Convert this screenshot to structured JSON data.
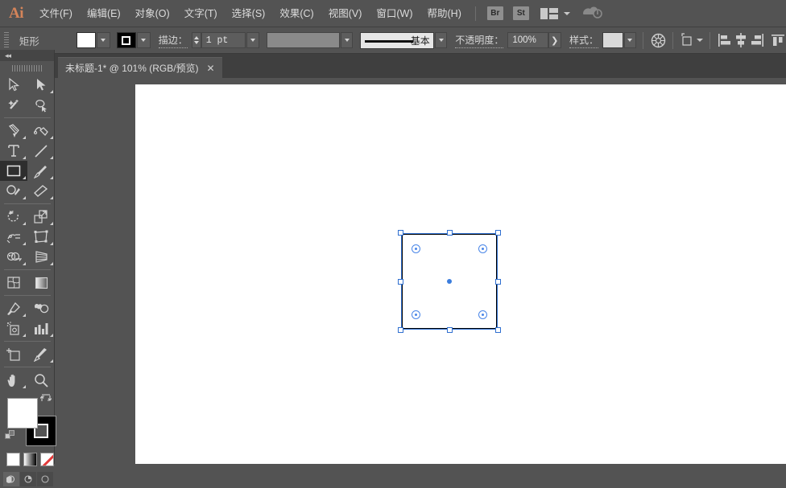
{
  "app": {
    "name": "Ai",
    "logo_color": "#d4845a"
  },
  "menubar": {
    "items": [
      {
        "label": "文件(F)",
        "name": "menu-file"
      },
      {
        "label": "编辑(E)",
        "name": "menu-edit"
      },
      {
        "label": "对象(O)",
        "name": "menu-object"
      },
      {
        "label": "文字(T)",
        "name": "menu-type"
      },
      {
        "label": "选择(S)",
        "name": "menu-select"
      },
      {
        "label": "效果(C)",
        "name": "menu-effect"
      },
      {
        "label": "视图(V)",
        "name": "menu-view"
      },
      {
        "label": "窗口(W)",
        "name": "menu-window"
      },
      {
        "label": "帮助(H)",
        "name": "menu-help"
      }
    ],
    "bridge_button": "Br",
    "stock_button": "St",
    "workspace_icon": "workspace-switcher-icon",
    "cc_icon": "creative-cloud-icon"
  },
  "controlbar": {
    "object_label": "矩形",
    "fill_color": "#ffffff",
    "stroke_color": "#000000",
    "stroke_label": "描边：",
    "stroke_weight": "1 pt",
    "profile_label": "",
    "brush_label": "基本",
    "opacity_label": "不透明度：",
    "opacity_value": "100%",
    "style_label": "样式：",
    "recolor_icon": "recolor-artwork-icon",
    "transform_icon": "transform-icon",
    "align_icons": [
      {
        "name": "align-left-icon"
      },
      {
        "name": "align-center-horizontal-icon"
      },
      {
        "name": "align-right-icon"
      },
      {
        "name": "align-top-icon"
      }
    ]
  },
  "tabbar": {
    "document_title": "未标题-1* @ 101% (RGB/预览)",
    "close_label": "✕"
  },
  "toolpanel": {
    "collapse_label": "◂◂",
    "tools": [
      {
        "name": "selection-tool",
        "row": 0,
        "col": 0,
        "selected": false
      },
      {
        "name": "direct-selection-tool",
        "row": 0,
        "col": 1,
        "selected": false
      },
      {
        "name": "magic-wand-tool",
        "row": 1,
        "col": 0,
        "selected": false
      },
      {
        "name": "lasso-tool",
        "row": 1,
        "col": 1,
        "selected": false
      },
      {
        "name": "pen-tool",
        "row": 2,
        "col": 0,
        "selected": false
      },
      {
        "name": "curvature-tool",
        "row": 2,
        "col": 1,
        "selected": false
      },
      {
        "name": "type-tool",
        "row": 3,
        "col": 0,
        "selected": false
      },
      {
        "name": "line-segment-tool",
        "row": 3,
        "col": 1,
        "selected": false
      },
      {
        "name": "rectangle-tool",
        "row": 4,
        "col": 0,
        "selected": true
      },
      {
        "name": "paintbrush-tool",
        "row": 4,
        "col": 1,
        "selected": false
      },
      {
        "name": "shaper-tool",
        "row": 5,
        "col": 0,
        "selected": false
      },
      {
        "name": "eraser-tool",
        "row": 5,
        "col": 1,
        "selected": false
      },
      {
        "name": "rotate-tool",
        "row": 6,
        "col": 0,
        "selected": false
      },
      {
        "name": "scale-tool",
        "row": 6,
        "col": 1,
        "selected": false
      },
      {
        "name": "width-tool",
        "row": 7,
        "col": 0,
        "selected": false
      },
      {
        "name": "free-transform-tool",
        "row": 7,
        "col": 1,
        "selected": false
      },
      {
        "name": "shape-builder-tool",
        "row": 8,
        "col": 0,
        "selected": false
      },
      {
        "name": "perspective-grid-tool",
        "row": 8,
        "col": 1,
        "selected": false
      },
      {
        "name": "mesh-tool",
        "row": 9,
        "col": 0,
        "selected": false
      },
      {
        "name": "gradient-tool",
        "row": 9,
        "col": 1,
        "selected": false
      },
      {
        "name": "eyedropper-tool",
        "row": 10,
        "col": 0,
        "selected": false
      },
      {
        "name": "blend-tool",
        "row": 10,
        "col": 1,
        "selected": false
      },
      {
        "name": "symbol-sprayer-tool",
        "row": 11,
        "col": 0,
        "selected": false
      },
      {
        "name": "column-graph-tool",
        "row": 11,
        "col": 1,
        "selected": false
      },
      {
        "name": "artboard-tool",
        "row": 12,
        "col": 0,
        "selected": false
      },
      {
        "name": "slice-tool",
        "row": 12,
        "col": 1,
        "selected": false
      },
      {
        "name": "hand-tool",
        "row": 13,
        "col": 0,
        "selected": false
      },
      {
        "name": "zoom-tool",
        "row": 13,
        "col": 1,
        "selected": false
      }
    ],
    "fill_color": "#ffffff",
    "stroke_color": "#000000",
    "swap_icon": "swap-fill-stroke-icon",
    "default_icon": "default-fill-stroke-icon",
    "color_mode_icons": [
      "color-swatch-icon",
      "gradient-swatch-icon",
      "none-swatch-icon"
    ],
    "draw_mode_icons": [
      "draw-normal-icon",
      "draw-behind-icon",
      "draw-inside-icon"
    ]
  },
  "canvas": {
    "artboard_color": "#ffffff",
    "background_color": "#535353",
    "selection_color": "#2f6fd0",
    "widget_color": "#4a86e8",
    "object": {
      "type": "rectangle",
      "fill": "#ffffff",
      "stroke": "#000000",
      "stroke_width": "1 pt",
      "handles": 8,
      "corner_radius_widgets": 4
    }
  }
}
